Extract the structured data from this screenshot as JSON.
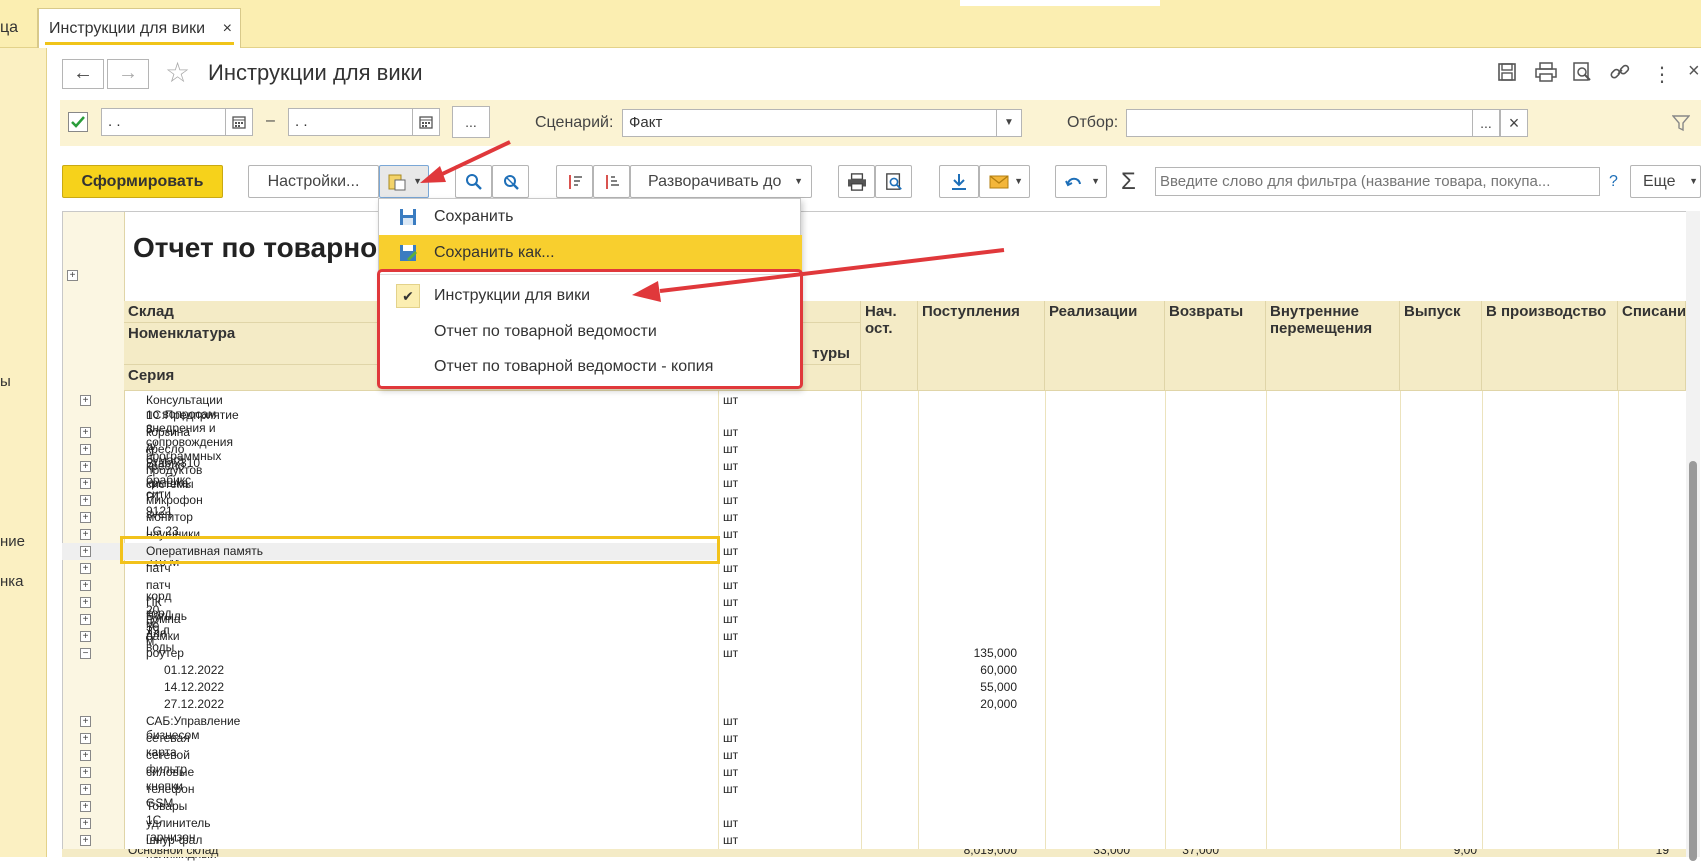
{
  "tabs": {
    "prev_label": "ца",
    "active_label": "Инструкции для вики",
    "close": "×"
  },
  "left_strip": {
    "fragments": [
      "ы",
      "ние",
      "нка"
    ]
  },
  "header": {
    "back": "←",
    "forward": "→",
    "star": "☆",
    "title": "Инструкции для вики",
    "more": "⋮",
    "close": "×"
  },
  "filter": {
    "date_from": " .  .",
    "dash": "–",
    "date_to": " .  .",
    "ellipsis": "...",
    "scenario_label": "Сценарий:",
    "scenario_value": "Факт",
    "selection_label": "Отбор:",
    "selection_value": "",
    "clear": "×"
  },
  "toolbar": {
    "generate": "Сформировать",
    "settings": "Настройки...",
    "expand_to": "Разворачивать до",
    "search_placeholder": "Введите слово для фильтра (название товара, покупа...",
    "help": "?",
    "more": "Еще",
    "sigma": "Σ"
  },
  "menu": {
    "items": [
      {
        "label": "Сохранить"
      },
      {
        "label": "Сохранить как..."
      },
      {
        "label": "Инструкции для вики",
        "checked": true
      },
      {
        "label": "Отчет по товарной ведомости"
      },
      {
        "label": "Отчет по товарной ведомости - копия"
      }
    ]
  },
  "report": {
    "title": "Отчет по товарно",
    "col_group": {
      "warehouse": "Склад",
      "nomenclature": "Номенклатура",
      "series": "Серия",
      "unit_partial": "туры"
    },
    "columns": [
      "Нач. ост.",
      "Поступления",
      "Реализации",
      "Возвраты",
      "Внутренние перемещения",
      "Выпуск",
      "В производство",
      "Списани"
    ],
    "rows": [
      {
        "name": "Консультации по вопросам внедрения и сопровождения программных продуктов системы",
        "name2": "1С:Предприятие 8  -",
        "unit": "шт",
        "value": ""
      },
      {
        "name": "корзина д/бумага",
        "unit": "шт",
        "value": ""
      },
      {
        "name": "кресло Brabix310",
        "unit": "шт",
        "value": ""
      },
      {
        "name": "кресло брабикс сити",
        "unit": "шт",
        "value": ""
      },
      {
        "name": "крышка РТ 9121",
        "unit": "шт",
        "value": ""
      },
      {
        "name": "микрофон sven",
        "unit": "шт",
        "value": ""
      },
      {
        "name": "монитор LG 23",
        "unit": "шт",
        "value": ""
      },
      {
        "name": "наушники Sven E-210 M",
        "unit": "шт",
        "value": ""
      },
      {
        "name": "Оперативная память",
        "unit": "шт",
        "value": ""
      },
      {
        "name": "патч - корд 20 м.",
        "unit": "шт",
        "value": ""
      },
      {
        "name": "патч - корд 30 м.",
        "unit": "шт",
        "value": ""
      },
      {
        "name": "ПК Бутыль 19 л",
        "unit": "шт",
        "value": ""
      },
      {
        "name": "помпа для воды",
        "unit": "шт",
        "value": ""
      },
      {
        "name": "рамки",
        "unit": "шт",
        "value": ""
      },
      {
        "name": "роутер",
        "unit": "шт",
        "value": "135,000",
        "expanded": true
      },
      {
        "name": "01.12.2022",
        "unit": "",
        "value": "60,000",
        "child": true
      },
      {
        "name": "14.12.2022",
        "unit": "",
        "value": "55,000",
        "child": true
      },
      {
        "name": "27.12.2022",
        "unit": "",
        "value": "20,000",
        "child": true
      },
      {
        "name": "САБ:Управление бизнесом",
        "unit": "шт",
        "value": ""
      },
      {
        "name": "сетевая карта",
        "unit": "шт",
        "value": ""
      },
      {
        "name": "сетевой фильтр",
        "unit": "шт",
        "value": ""
      },
      {
        "name": "силовые кнопки",
        "unit": "шт",
        "value": ""
      },
      {
        "name": "телефон GSM",
        "unit": "шт",
        "value": ""
      },
      {
        "name": "Товары 1С",
        "unit": "",
        "value": ""
      },
      {
        "name": "удлинитель гарнизон",
        "unit": "шт",
        "value": ""
      },
      {
        "name": "шнур-фал полимидный",
        "unit": "шт",
        "value": ""
      }
    ],
    "total_row": {
      "name": "Основной склад",
      "values": [
        "8,019,000",
        "33,000",
        "37,000",
        "9,00",
        "19"
      ]
    }
  },
  "colors": {
    "accent": "#f6d21b",
    "highlight_red": "#e0383b",
    "header_bg": "#f4ebc6"
  }
}
